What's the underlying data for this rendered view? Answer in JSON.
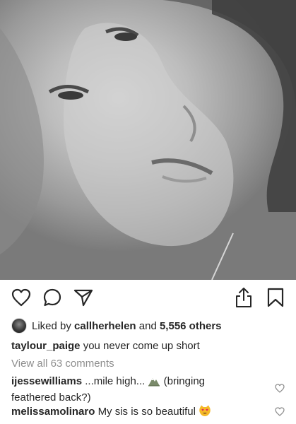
{
  "post": {
    "liked_by_prefix": "Liked by",
    "liked_by_user": "callherhelen",
    "and_text": "and",
    "others_text": "5,556 others"
  },
  "caption": {
    "username": "taylour_paige",
    "text": "you never come up short"
  },
  "view_all": "View all 63 comments",
  "comments": [
    {
      "username": "ijessewilliams",
      "text_before": "...mile high...",
      "text_after": "(bringing feathered back?)"
    },
    {
      "username": "melissamolinaro",
      "text": "My sis is so beautiful"
    }
  ],
  "icons": {
    "like": "heart-icon",
    "comment": "comment-icon",
    "share": "send-icon",
    "upload": "share-upload-icon",
    "save": "bookmark-icon"
  }
}
